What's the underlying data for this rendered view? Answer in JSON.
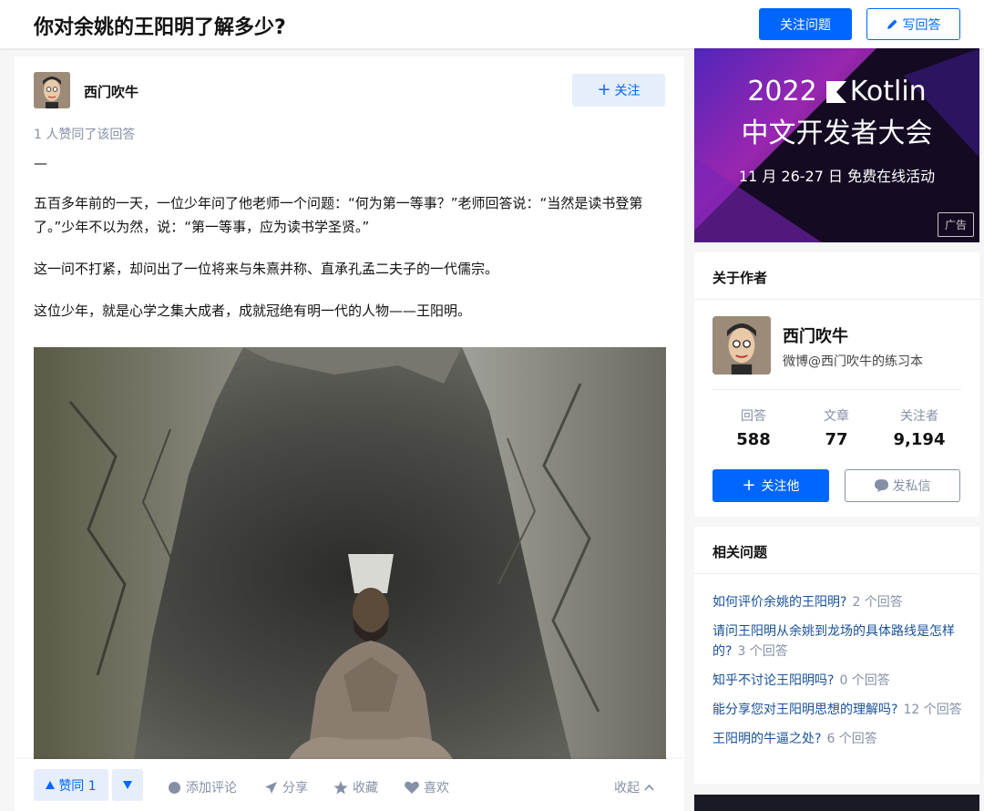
{
  "header": {
    "question_title": "你对余姚的王阳明了解多少?",
    "follow_question_label": "关注问题",
    "write_answer_label": "写回答"
  },
  "answer": {
    "author_name": "西门吹牛",
    "follow_label": "关注",
    "voters_text": "1 人赞同了该回答",
    "dash": "—",
    "paragraphs": [
      "五百多年前的一天，一位少年问了他老师一个问题：“何为第一等事？”老师回答说：“当然是读书登第了。”少年不以为然，说：“第一等事，应为读书学圣贤。”",
      "这一问不打紧，却问出了一位将来与朱熹并称、直承孔孟二夫子的一代儒宗。",
      "这位少年，就是心学之集大成者，成就冠绝有明一代的人物——王阳明。"
    ]
  },
  "actions": {
    "upvote_label": "赞同 1",
    "comment_label": "添加评论",
    "share_label": "分享",
    "collect_label": "收藏",
    "like_label": "喜欢",
    "collapse_label": "收起"
  },
  "ad": {
    "line1_year": "2022",
    "line1_brand": "Kotlin",
    "line2": "中文开发者大会",
    "line3": "11 月 26-27 日 免费在线活动",
    "tag": "广告"
  },
  "about_author": {
    "title": "关于作者",
    "name": "西门吹牛",
    "bio": "微博@西门吹牛的练习本",
    "stats": [
      {
        "label": "回答",
        "value": "588"
      },
      {
        "label": "文章",
        "value": "77"
      },
      {
        "label": "关注者",
        "value": "9,194"
      }
    ],
    "follow_label": "关注他",
    "message_label": "发私信"
  },
  "related": {
    "title": "相关问题",
    "items": [
      {
        "question": "如何评价余姚的王阳明?",
        "count": "2 个回答"
      },
      {
        "question": "请问王阳明从余姚到龙场的具体路线是怎样的?",
        "count": "3 个回答"
      },
      {
        "question": "知乎不讨论王阳明吗?",
        "count": "0 个回答"
      },
      {
        "question": "能分享您对王阳明思想的理解吗?",
        "count": "12 个回答"
      },
      {
        "question": "王阳明的牛逼之处?",
        "count": "6 个回答"
      }
    ]
  },
  "colors": {
    "brand_blue": "#0066ff",
    "link_blue": "#175199",
    "muted_gray": "#8590a6"
  }
}
